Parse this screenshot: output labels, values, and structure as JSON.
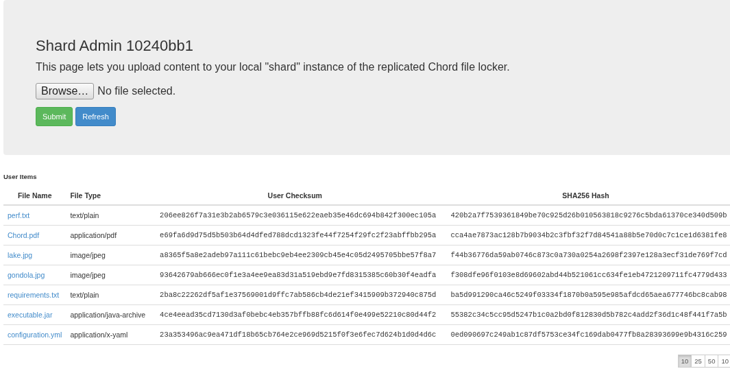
{
  "header": {
    "title": "Shard Admin 10240bb1",
    "description": "This page lets you upload content to your local \"shard\" instance of the replicated Chord file locker.",
    "file_input": {
      "button": "Browse…",
      "status": "No file selected."
    },
    "buttons": [
      {
        "label": "Submit",
        "kind": "success"
      },
      {
        "label": "Refresh",
        "kind": "primary"
      }
    ]
  },
  "table": {
    "title": "User Items",
    "columns": [
      "File Name",
      "File Type",
      "User Checksum",
      "SHA256 Hash"
    ],
    "rows": [
      {
        "name": "perf.txt",
        "type": "text/plain",
        "checksum": "206ee826f7a31e3b2ab6579c3e036115e622eaeb35e46dc694b842f300ec105a",
        "sha256": "420b2a7f7539361849be70c925d26b010563818c9276c5bda61370ce340d509b"
      },
      {
        "name": "Chord.pdf",
        "type": "application/pdf",
        "checksum": "e69fa6d9d75d5b503b64d4dfed788dcd1323fe44f7254f29fc2f23abffbb295a",
        "sha256": "cca4ae7873ac128b7b9034b2c3fbf32f7d84541a88b5e70d0c7c1ce1d6381fe8"
      },
      {
        "name": "lake.jpg",
        "type": "image/jpeg",
        "checksum": "a8365f5a8e2adeb97a111c61bebc9eb4ee2309cb45e4c05d2495705bbe57f8a7",
        "sha256": "f44b36776da59ab0746c873c0a730a0254a2698f2397e128a3ecf31de769f7cd"
      },
      {
        "name": "gondola.jpg",
        "type": "image/jpeg",
        "checksum": "93642679ab666ec0f1e3a4ee9ea83d31a519ebd9e7fd8315385c60b30f4eadfa",
        "sha256": "f308dfe96f0103e8d69602abd44b521061cc634fe1eb4721209711fc4779d433"
      },
      {
        "name": "requirements.txt",
        "type": "text/plain",
        "checksum": "2ba8c22262df5af1e37569001d9ffc7ab586cb4de21ef3415909b372940c875d",
        "sha256": "ba5d991290ca46c5249f03334f1870b0a595e985afdcd65aea677746bc8cab98"
      },
      {
        "name": "executable.jar",
        "type": "application/java-archive",
        "checksum": "4ce4eead35cd7130d3af0bebc4eb357bffb88fc6d614f0e499e52210c80d44f2",
        "sha256": "55382c34c5cc95d5247b1c0a2bd0f812830d5b782c4add2f36d1c48f441f7a5b"
      },
      {
        "name": "configuration.yml",
        "type": "application/x-yaml",
        "checksum": "23a353496ac9ea471df18b65cb764e2ce969d5215f0f3e6fec7d624b1d0d4d6c",
        "sha256": "0ed090697c249ab1c87df5753ce34fc169dab0477fb8a28393699e9b4316c259"
      }
    ],
    "page_sizes": [
      {
        "label": "10",
        "selected": true
      },
      {
        "label": "25",
        "selected": false
      },
      {
        "label": "50",
        "selected": false
      },
      {
        "label": "10",
        "selected": false
      }
    ]
  }
}
